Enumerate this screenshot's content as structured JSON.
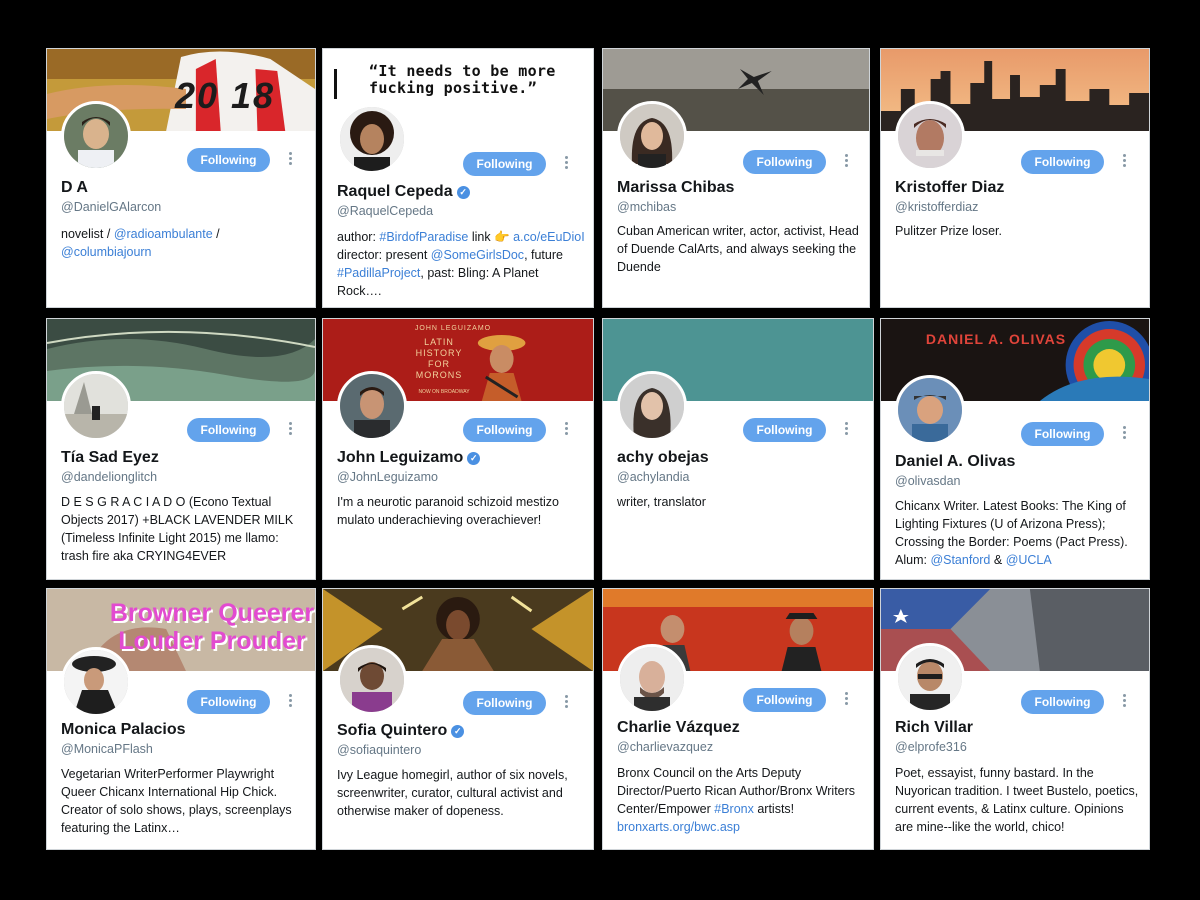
{
  "follow_label": "Following",
  "colors": {
    "button": "#63a3ec",
    "link": "#3b7fd6",
    "background": "#000000"
  },
  "cards": [
    {
      "name": "D A",
      "handle": "@DanielGAlarcon",
      "verified": false,
      "bio": [
        {
          "t": "novelist / "
        },
        {
          "t": "@radioambulante",
          "link": true
        },
        {
          "t": " / "
        },
        {
          "t": "@columbiajourn",
          "link": true
        }
      ],
      "banner_text": "20 18"
    },
    {
      "name": "Raquel Cepeda",
      "handle": "@RaquelCepeda",
      "verified": true,
      "bio": [
        {
          "t": "author: "
        },
        {
          "t": "#BirdofParadise",
          "link": true
        },
        {
          "t": " link 👉 "
        },
        {
          "t": "a.co/eEuDioI",
          "link": true
        },
        {
          "t": " director: present "
        },
        {
          "t": "@SomeGirlsDoc",
          "link": true
        },
        {
          "t": ", future "
        },
        {
          "t": "#PadillaProject",
          "link": true
        },
        {
          "t": ", past: Bling: A Planet Rock…."
        }
      ],
      "banner_text": "“It needs to be more fucking positive.”"
    },
    {
      "name": "Marissa Chibas",
      "handle": "@mchibas",
      "verified": false,
      "bio": [
        {
          "t": "Cuban American writer, actor, activist, Head of Duende CalArts, and always seeking the Duende"
        }
      ]
    },
    {
      "name": "Kristoffer Diaz",
      "handle": "@kristofferdiaz",
      "verified": false,
      "bio": [
        {
          "t": "Pulitzer Prize loser."
        }
      ]
    },
    {
      "name": "Tía Sad Eyez",
      "handle": "@dandelionglitch",
      "verified": false,
      "bio": [
        {
          "t": "D E S G R A C I A D O (Econo Textual Objects 2017) +BLACK LAVENDER MILK (Timeless Infinite Light 2015) me llamo: trash fire aka CRYING4EVER"
        }
      ]
    },
    {
      "name": "John Leguizamo",
      "handle": "@JohnLeguizamo",
      "verified": true,
      "bio": [
        {
          "t": "I'm a neurotic paranoid schizoid mestizo mulato underachieving overachiever!"
        }
      ],
      "banner_text": "JOHN LEGUIZAMO",
      "banner_text2": "LATIN HISTORY FOR MORONS",
      "banner_text3": "NOW ON BROADWAY"
    },
    {
      "name": "achy obejas",
      "handle": "@achylandia",
      "verified": false,
      "bio": [
        {
          "t": "writer, translator"
        }
      ]
    },
    {
      "name": "Daniel A. Olivas",
      "handle": "@olivasdan",
      "verified": false,
      "bio": [
        {
          "t": "Chicanx Writer. Latest Books: The King of Lighting Fixtures (U of Arizona Press); Crossing the Border: Poems (Pact Press). Alum: "
        },
        {
          "t": "@Stanford",
          "link": true
        },
        {
          "t": " & "
        },
        {
          "t": "@UCLA",
          "link": true
        }
      ],
      "banner_text": "DANIEL A. OLIVAS"
    },
    {
      "name": "Monica Palacios",
      "handle": "@MonicaPFlash",
      "verified": false,
      "bio": [
        {
          "t": "Vegetarian WriterPerformer Playwright Queer Chicanx International Hip Chick. Creator of solo shows, plays, screenplays featuring the Latinx…"
        }
      ],
      "banner_text": "Browner Queerer",
      "banner_text2": "Louder Prouder"
    },
    {
      "name": "Sofia Quintero",
      "handle": "@sofiaquintero",
      "verified": true,
      "bio": [
        {
          "t": "Ivy League homegirl, author of six novels, screenwriter, curator, cultural activist and otherwise maker of dopeness."
        }
      ]
    },
    {
      "name": "Charlie Vázquez",
      "handle": "@charlievazquez",
      "verified": false,
      "bio": [
        {
          "t": "Bronx Council on the Arts Deputy Director/Puerto Rican Author/Bronx Writers Center/Empower "
        },
        {
          "t": "#Bronx",
          "link": true
        },
        {
          "t": " artists! "
        },
        {
          "t": "bronxarts.org/bwc.asp",
          "link": true
        }
      ]
    },
    {
      "name": "Rich Villar",
      "handle": "@elprofe316",
      "verified": false,
      "bio": [
        {
          "t": "Poet, essayist, funny bastard. In the Nuyorican tradition. I tweet Bustelo, poetics, current events, & Latinx culture. Opinions are mine--like the world, chico!"
        }
      ]
    }
  ]
}
